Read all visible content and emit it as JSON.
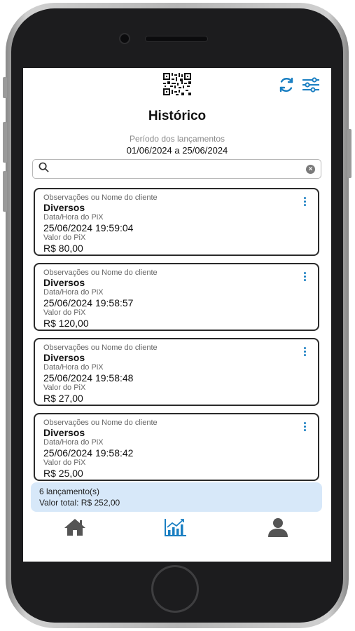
{
  "header": {
    "qr_icon": "qr-code-icon",
    "refresh_icon": "refresh-icon",
    "filter_icon": "sliders-icon",
    "title": "Histórico",
    "period_label": "Período dos lançamentos",
    "period_value": "01/06/2024 a 25/06/2024"
  },
  "search": {
    "placeholder": "",
    "value": ""
  },
  "entries": [
    {
      "obs_label": "Observações ou Nome do cliente",
      "name": "Diversos",
      "date_label": "Data/Hora do PiX",
      "date": "25/06/2024 19:59:04",
      "value_label": "Valor do PiX",
      "value": "R$ 80,00"
    },
    {
      "obs_label": "Observações ou Nome do cliente",
      "name": "Diversos",
      "date_label": "Data/Hora do PiX",
      "date": "25/06/2024 19:58:57",
      "value_label": "Valor do PiX",
      "value": "R$ 120,00"
    },
    {
      "obs_label": "Observações ou Nome do cliente",
      "name": "Diversos",
      "date_label": "Data/Hora do PiX",
      "date": "25/06/2024 19:58:48",
      "value_label": "Valor do PiX",
      "value": "R$ 27,00"
    },
    {
      "obs_label": "Observações ou Nome do cliente",
      "name": "Diversos",
      "date_label": "Data/Hora do PiX",
      "date": "25/06/2024 19:58:42",
      "value_label": "Valor do PiX",
      "value": "R$ 25,00"
    }
  ],
  "summary": {
    "count": "6 lançamento(s)",
    "total": "Valor total: R$ 252,00"
  },
  "tabs": [
    {
      "icon": "home-icon"
    },
    {
      "icon": "chart-icon",
      "active": true
    },
    {
      "icon": "user-icon"
    }
  ],
  "colors": {
    "accent": "#1a7fc2",
    "summary_bg": "#d7e8f9",
    "tab_inactive": "#555555"
  }
}
